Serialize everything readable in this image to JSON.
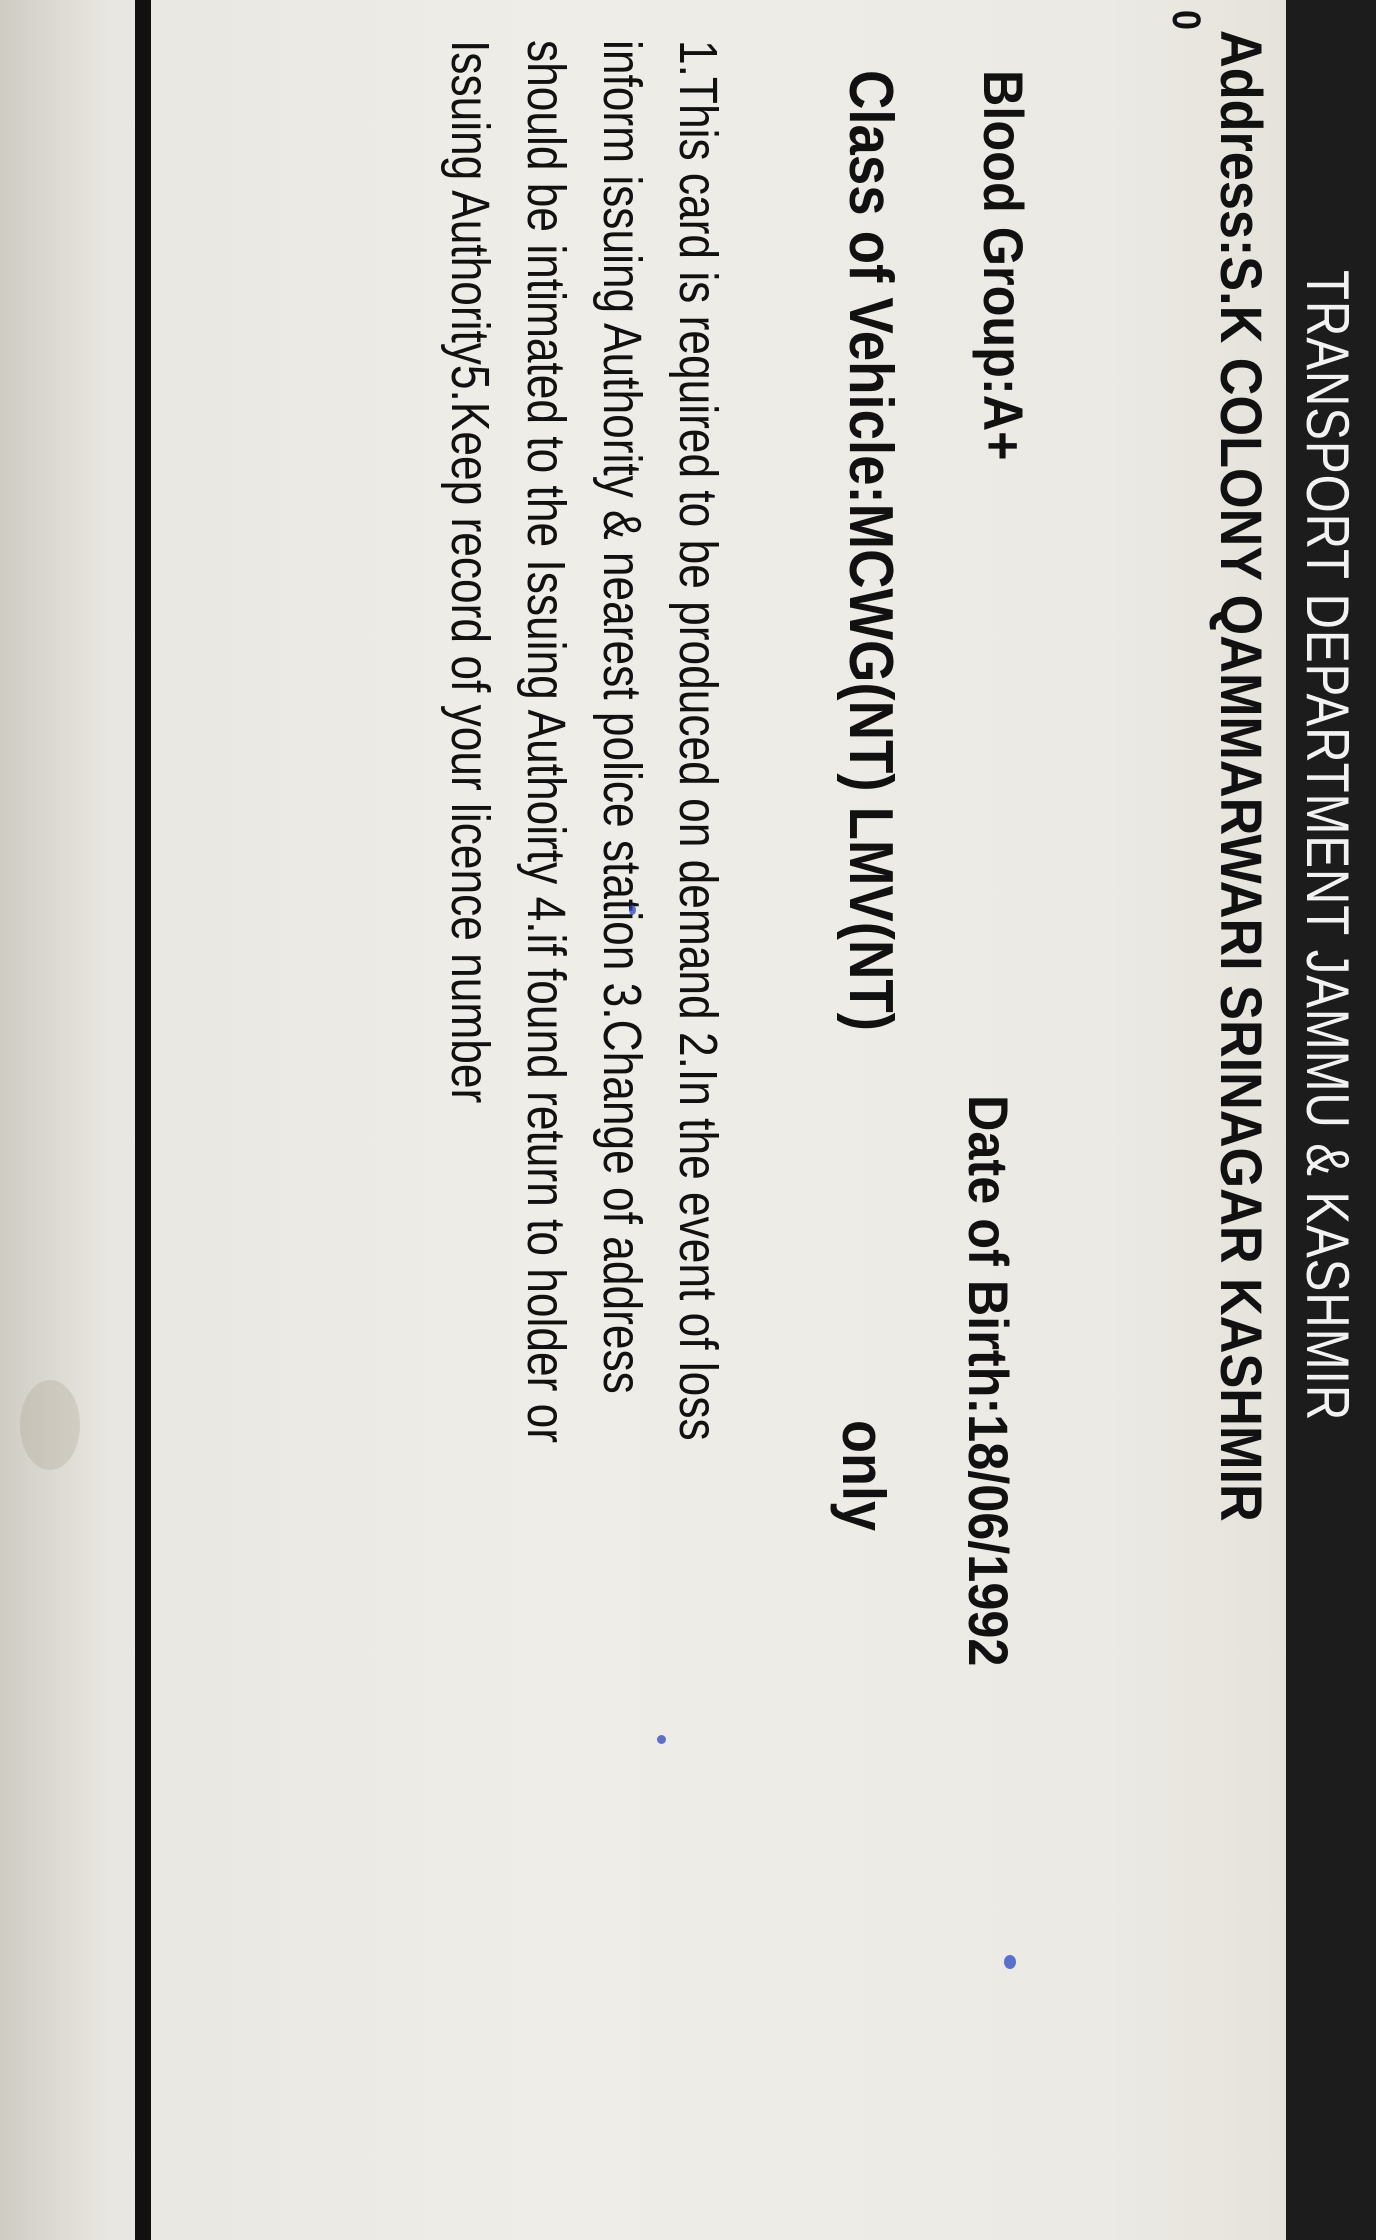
{
  "card": {
    "header_title": "TRANSPORT DEPARTMENT JAMMU & KASHMIR",
    "address": "Address:S.K COLONY QAMMARWARI  SRINAGAR KASHMIR",
    "address_cont": "0",
    "blood_group": "Blood Group:A+",
    "date_of_birth": "Date of Birth:18/06/1992",
    "vehicle_class": "Class of Vehicle:MCWG(NT) LMV(NT)",
    "vehicle_class_suffix": "only",
    "notes": [
      "1.This card is required to be produced on demand 2.In the event of loss",
      "inform issuing Authority & nearest police station 3.Change of address",
      "should be intimated to the Issuing Authoirty 4.if found return to holder or",
      "Issuing Authority5.Keep record of your licence number"
    ]
  }
}
